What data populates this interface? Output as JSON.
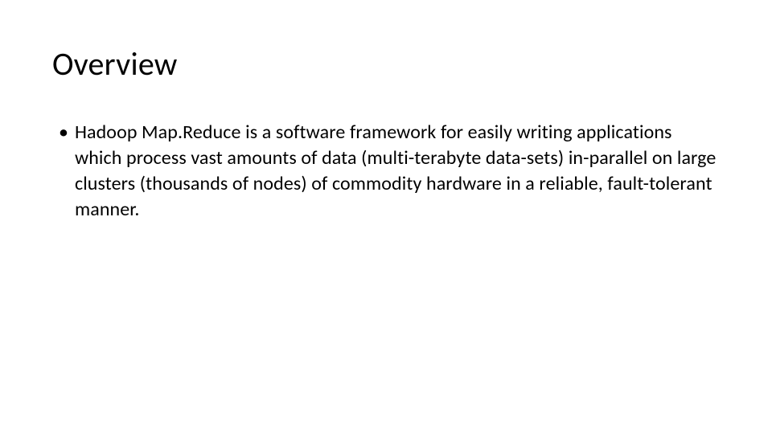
{
  "slide": {
    "title": "Overview",
    "bullets": [
      {
        "text": "Hadoop Map.Reduce is a software framework for easily writing applications which process vast amounts of data (multi-terabyte data-sets) in-parallel on large clusters (thousands of nodes) of commodity hardware in a reliable, fault-tolerant manner."
      }
    ],
    "bullet_marker": "•"
  }
}
